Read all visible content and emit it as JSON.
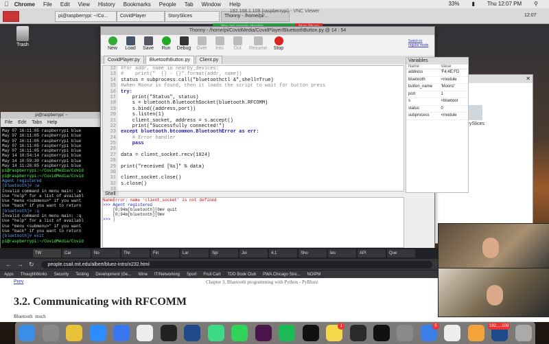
{
  "mac_menubar": {
    "app": "Chrome",
    "menus": [
      "File",
      "Edit",
      "View",
      "History",
      "Bookmarks",
      "People",
      "Tab",
      "Window",
      "Help"
    ],
    "battery": "33%",
    "clock": "Thu 12:07 PM"
  },
  "pi_taskbar": {
    "tasks": [
      "pi@raspberrypi: ~/Co...",
      "CovidPlayer",
      "StorySlices",
      "Thonny - /home/pi/..."
    ],
    "clock": "12:07"
  },
  "vnc": {
    "title": "192.168.1.109 (raspberrypi) - VNC Viewer",
    "sharing": "You are screen sharing",
    "stop": "Stop Share"
  },
  "desktop": {
    "trash_label": "Trash"
  },
  "thonny": {
    "title": "Thonny - /home/pi/CovidMedia/CovidPlayer/BluetoothButton.py @ 14 : 54",
    "toolbar": [
      "New",
      "Load",
      "Save",
      "Run",
      "Debug",
      "Over",
      "Into",
      "Out",
      "Resume",
      "Stop"
    ],
    "switch_link": "Switch to regular mode",
    "tabs": [
      "CovidPlayer.py",
      "BluetoothButton.py",
      "Client.py"
    ],
    "gutter": [
      "12",
      "13",
      "14",
      "15",
      "16",
      "17",
      "18",
      "19",
      "20",
      "21",
      "22",
      "23",
      "24",
      "25",
      "26",
      "27",
      "28",
      "29",
      "30",
      "31",
      "32",
      "33"
    ],
    "code": [
      "#for addr, name in nearby_devices:",
      "#    print(\"  {} - {}\".format(addr, name))",
      "status = subprocess.call(\"bluetoothctl &\",shell=True)",
      "#when Moonz is found, then it loads the script to wait for button press",
      "try:",
      "    print(\"Status\", status)",
      "    s = bluetooth.BluetoothSocket(bluetooth.RFCOMM)",
      "    s.bind((address,port))",
      "    s.listen(1)",
      "    client_socket, address = s.accept()",
      "    print(\"Successfully connected!\")",
      "except bluetooth.btcommon.BluetoothError as err:",
      "    # Error handler",
      "    pass",
      "",
      "data = client_socket.recv(1024)",
      "",
      "print(\"received [%s]\" % data)",
      "",
      "client_socket.close()",
      "s.close()",
      ""
    ],
    "variables": {
      "header": "Variables",
      "name_col": "Name",
      "value_col": "Value",
      "rows": [
        {
          "name": "address",
          "value": "'F4:4E:FD"
        },
        {
          "name": "bluetooth",
          "value": "<module"
        },
        {
          "name": "button_name",
          "value": "'Moonz'"
        },
        {
          "name": "port",
          "value": "1"
        },
        {
          "name": "s",
          "value": "<bluetoot"
        },
        {
          "name": "status",
          "value": "0"
        },
        {
          "name": "subprocess",
          "value": "<module"
        }
      ]
    },
    "shell": {
      "header": "Shell",
      "lines": [
        "NameError: name 'client_socket' is not defined",
        "",
        ">>> Agent registered",
        "    [0;94m[bluetooth][0m# quit",
        "    [0;94m[bluetooth][0m#",
        "",
        ">>> |"
      ]
    }
  },
  "file_manager": {
    "item": "StorySlices"
  },
  "terminal": {
    "title": "pi@raspberrypi: ~",
    "menu": [
      "File",
      "Edit",
      "Tabs",
      "Help"
    ],
    "lines": [
      "May 07 16:11:05 raspberrypi blue",
      "May 07 16:11:05 raspberrypi blue",
      "May 07 16:11:05 raspberrypi blue",
      "May 07 16:11:05 raspberrypi blue",
      "May 07 16:11:05 raspberrypi blue",
      "May 14 10:54:14 raspberrypi blue",
      "May 14 10:59:30 raspberrypi blue",
      "May 14 11:26:05 raspberrypi blue",
      "pi@raspberrypi:~/CovidMedia/Covid",
      "pi@raspberrypi:~/CovidMedia/Covid",
      "Agent registered",
      "[bluetooth]# :w",
      "Invalid command in menu main: :w",
      "",
      "Use \"help\" for a list of availabl",
      "Use \"menu <submenu>\" if you want",
      "Use \"back\" if you want to return",
      "[bluetooth]# :q",
      "Invalid command in menu main: :q",
      "",
      "Use \"help\" for a list of availabl",
      "Use \"menu <submenu>\" if you want",
      "Use \"back\" if you want to return",
      "[bluetooth]# exit",
      "pi@raspberrypi:~/CovidMedia/Covid"
    ]
  },
  "chrome": {
    "tabs": [
      "TW",
      "Car",
      "No",
      "Thc",
      "Fin",
      "Lar",
      "Spi",
      "Joi",
      "4.1",
      "Sho",
      "tes",
      "API",
      "Que"
    ],
    "url": "people.csail.mit.edu/albert/bluez-intro/x232.html",
    "bookmarks": [
      "Apps",
      "ThoughtWorks",
      "Security",
      "Testing",
      "Development (Ge...",
      "Wine",
      "IT/Networking",
      "Sport",
      "Fruit Cart",
      "TDD Book Club",
      "PWA Chicago Stre...",
      "NOIPM"
    ],
    "prev": "Prev",
    "chapter": "Chapter 3. Bluetooth programming with Python - PyBluez",
    "heading": "3.2. Communicating with RFCOMM",
    "body_start": "Bluetooth",
    "body_next": "much"
  },
  "dock": {
    "badges": {
      "mail": "5",
      "notes": "1"
    },
    "vnc_label": "192.....109"
  }
}
